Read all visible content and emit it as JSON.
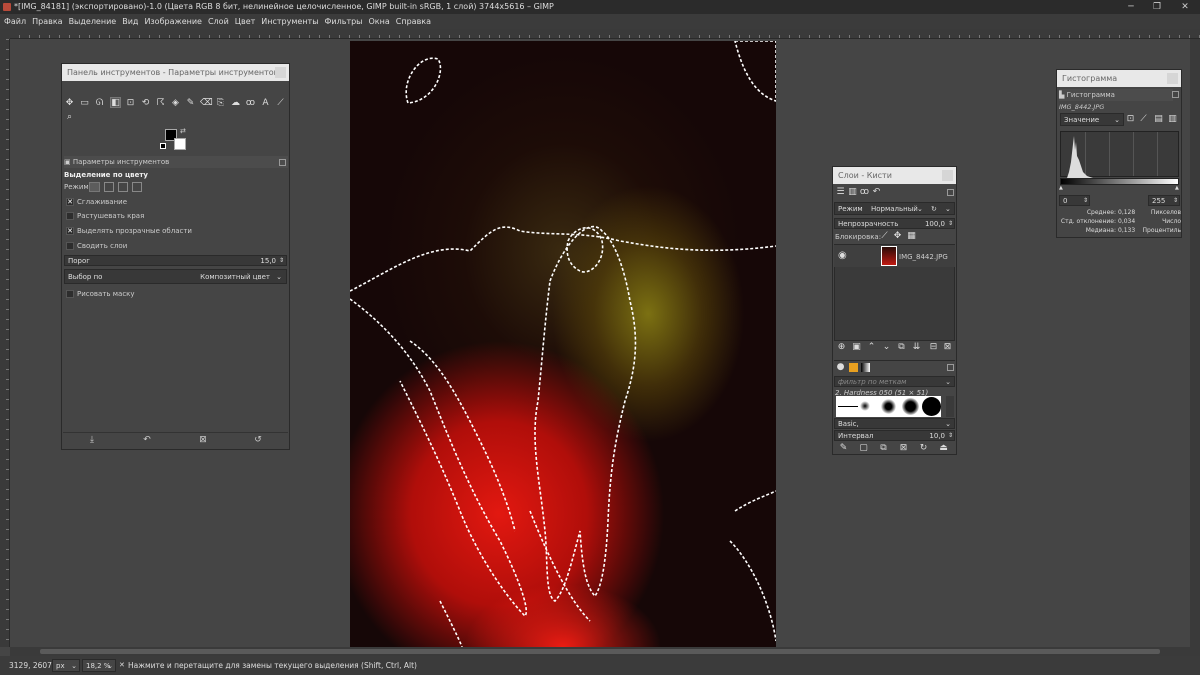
{
  "window": {
    "title": "*[IMG_84181] (экспортировано)-1.0 (Цвета RGB 8 бит, нелинейное целочисленное, GIMP built-in sRGB, 1 слой) 3744x5616 – GIMP",
    "minimize": "─",
    "maximize": "❐",
    "close": "✕"
  },
  "menu": [
    "Файл",
    "Правка",
    "Выделение",
    "Вид",
    "Изображение",
    "Слой",
    "Цвет",
    "Инструменты",
    "Фильтры",
    "Окна",
    "Справка"
  ],
  "toolbox": {
    "title": "Панель инструментов - Параметры инструментов",
    "options_tab": "Параметры инструментов",
    "tool_name": "Выделение по цвету",
    "mode_label": "Режим:",
    "antialias": {
      "label": "Сглаживание",
      "checked": true
    },
    "feather": {
      "label": "Растушевать края",
      "checked": false
    },
    "transparent": {
      "label": "Выделять прозрачные области",
      "checked": true
    },
    "merged": {
      "label": "Сводить слои",
      "checked": false
    },
    "threshold": {
      "label": "Порог",
      "value": "15,0"
    },
    "select_by": {
      "label": "Выбор по",
      "value": "Композитный цвет"
    },
    "draw_mask": {
      "label": "Рисовать маску",
      "checked": false
    }
  },
  "layers": {
    "title": "Слои - Кисти",
    "mode_label": "Режим",
    "mode_value": "Нормальный",
    "opacity_label": "Непрозрачность",
    "opacity_value": "100,0",
    "lock_label": "Блокировка:",
    "layer_name": "IMG_8442.JPG",
    "brush_filter_placeholder": "фильтр по меткам",
    "brush_name": "2. Hardness 050 (51 × 51)",
    "brush_set": "Basic,",
    "spacing_label": "Интервал",
    "spacing_value": "10,0"
  },
  "histogram": {
    "title": "Гистограмма",
    "tab": "Гистограмма",
    "image": "IMG_8442.JPG",
    "channel": "Значение",
    "range_min": "0",
    "range_max": "255",
    "mean_label": "Среднее:",
    "mean_value": "0,128",
    "std_label": "Стд. отклонение:",
    "std_value": "0,034",
    "median_label": "Медиана:",
    "median_value": "0,133",
    "pixels_label": "Пикселов",
    "count_label": "Число",
    "percentile_label": "Процентиль"
  },
  "status": {
    "coords": "3129, 2607",
    "unit": "px",
    "zoom": "18,2 %",
    "message": "Нажмите и перетащите для замены текущего выделения (Shift, Ctrl, Alt)"
  }
}
